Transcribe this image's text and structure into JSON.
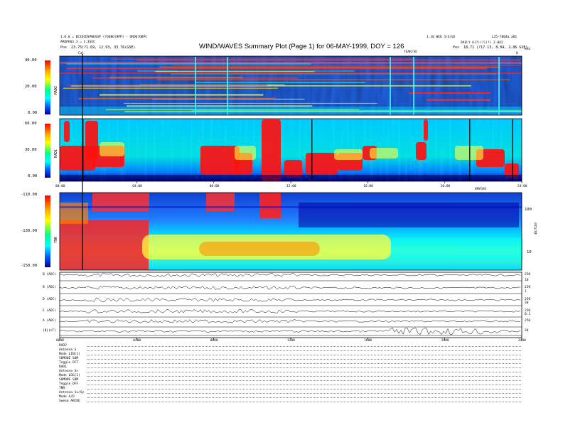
{
  "header": {
    "title": "WIND/WAVES Summary Plot (Page 1) for 06-MAY-1999, DOY = 126",
    "left_line1": "1.0.0 = BCIQCDSPWOSSP (?QOBO(BPP) - ORDQ?QBPC",
    "left_line2": "ARQPHQ3.3 = 1.3SEC",
    "left_line3_label": "Pos",
    "left_line3_value": "23.75(?1.69, 12.93, 33.76(GSE)",
    "right_line1": "1.10 WED 3/4/02",
    "right_line2": "DAILY 6(?)(?)(?) 2.0A2",
    "right_line3_label": "Pos",
    "right_line3_value": "18.71 (?17.13, 8.04, 2.86 GSE)",
    "right_corner": "LZ5-7004a.a01",
    "far_right": "kHz",
    "cal_marker": "Cal",
    "mid_marker": "YEAR/SE",
    "mid_marker2": "0"
  },
  "panels": {
    "rad2": {
      "axis_label": "RAD2",
      "ticks": [
        "40.00",
        "20.00",
        "0.00"
      ]
    },
    "rad1": {
      "axis_label": "RAD1",
      "ticks": [
        "60.00",
        "30.00",
        "0.00"
      ]
    },
    "tnr": {
      "axis_label": "TNR",
      "ticks": [
        "-110.00",
        "-130.00",
        "-150.00"
      ],
      "right_ticks": [
        "100",
        "10"
      ],
      "right_label": "dB/f100"
    }
  },
  "time_axis": {
    "ticks": [
      "00:00",
      "04:00",
      "08:00",
      "12:00",
      "16:00",
      "20:00",
      "24:00"
    ],
    "right_note": "6MYG93"
  },
  "time_axis_bottom": {
    "ticks": [
      "0000",
      "0400",
      "0800",
      "1200",
      "1600",
      "2000",
      "2400"
    ]
  },
  "traces": [
    {
      "label": "B (ADC)",
      "right": "250"
    },
    {
      "label": "B (ADC)",
      "right": "250"
    },
    {
      "label": "D (ADC)",
      "right": "250"
    },
    {
      "label": "E (ADC)",
      "right": "250"
    },
    {
      "label": "A (ADC)",
      "right": "250"
    },
    {
      "label": "|B|(nT)",
      "right": "20"
    }
  ],
  "trace_right_extra": [
    "10",
    "1",
    "30",
    "0.1"
  ],
  "settings": [
    {
      "k": "RAD2",
      "v": ""
    },
    {
      "k": "Antenna",
      "v": "S"
    },
    {
      "k": "Mode",
      "v": "LIN(1)"
    },
    {
      "k": "SUMODE",
      "v": "SUM"
    },
    {
      "k": "Toggle",
      "v": "OFF"
    },
    {
      "k": "RAD1",
      "v": ""
    },
    {
      "k": "Antenna",
      "v": "S+"
    },
    {
      "k": "Mode",
      "v": "LOG(1)"
    },
    {
      "k": "SUMODE",
      "v": "SUM"
    },
    {
      "k": "Toggle",
      "v": "OFF"
    },
    {
      "k": "TNR",
      "v": ""
    },
    {
      "k": "Antenna",
      "v": "Sx/Sy"
    },
    {
      "k": "Mode",
      "v": "A/D"
    },
    {
      "k": "Sweep",
      "v": "ABCDE"
    }
  ],
  "colors": {
    "low": "#0000a0",
    "mid": "#00ffff",
    "high": "#ff0000"
  },
  "chart_data": {
    "type": "heatmap",
    "title": "WIND/WAVES Summary Plot (Page 1) for 06-MAY-1999, DOY = 126",
    "x": {
      "label": "",
      "range": [
        "00:00",
        "24:00"
      ]
    },
    "panels": [
      {
        "name": "RAD2",
        "ylim": [
          0,
          40
        ]
      },
      {
        "name": "RAD1",
        "ylim": [
          0,
          60
        ]
      },
      {
        "name": "TNR",
        "ylim": [
          -150,
          -110
        ]
      }
    ]
  }
}
